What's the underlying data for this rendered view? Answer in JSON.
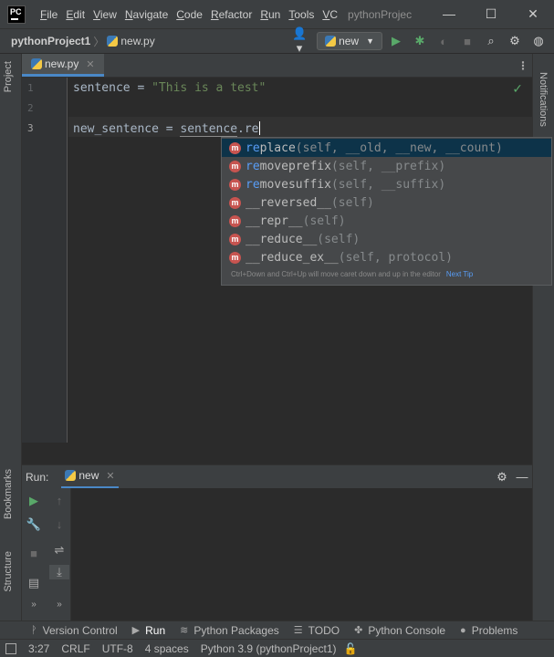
{
  "titlebar": {
    "logo_text": "PC",
    "menu": [
      "File",
      "Edit",
      "View",
      "Navigate",
      "Code",
      "Refactor",
      "Run",
      "Tools",
      "VC"
    ],
    "title": "pythonProjec",
    "minimize": "—",
    "maximize": "☐",
    "close": "✕"
  },
  "navbar": {
    "project": "pythonProject1",
    "file": "new.py",
    "run_config": "new"
  },
  "left_stripe": {
    "project_tab": "Project",
    "bookmarks_tab": "Bookmarks",
    "structure_tab": "Structure"
  },
  "right_stripe": {
    "notifications_tab": "Notifications"
  },
  "editor": {
    "tab_label": "new.py",
    "line_numbers": [
      "1",
      "2",
      "3"
    ],
    "line1_ident": "sentence",
    "line1_op": " = ",
    "line1_string": "\"This is a test\"",
    "line3_prefix": "new_sentence = ",
    "line3_ident": "sentence",
    "line3_dot": ".re"
  },
  "completion": {
    "items": [
      {
        "match": "re",
        "rest": "place",
        "sig": "(self, __old, __new, __count)"
      },
      {
        "match": "re",
        "rest": "moveprefix",
        "sig": "(self, __prefix)"
      },
      {
        "match": "re",
        "rest": "movesuffix",
        "sig": "(self, __suffix)"
      },
      {
        "match": "",
        "rest": "__reversed__",
        "sig": "(self)"
      },
      {
        "match": "",
        "rest": "__repr__",
        "sig": "(self)"
      },
      {
        "match": "",
        "rest": "__reduce__",
        "sig": "(self)"
      },
      {
        "match": "",
        "rest": "__reduce_ex__",
        "sig": "(self, protocol)"
      }
    ],
    "icon_letter": "m",
    "hint": "Ctrl+Down and Ctrl+Up will move caret down and up in the editor",
    "next_tip": "Next Tip"
  },
  "run": {
    "label": "Run:",
    "tab": "new"
  },
  "bottom_tabs": [
    {
      "icon": "ᚹ",
      "label": "Version Control",
      "active": false
    },
    {
      "icon": "▶",
      "label": "Run",
      "active": true
    },
    {
      "icon": "≋",
      "label": "Python Packages",
      "active": false
    },
    {
      "icon": "☰",
      "label": "TODO",
      "active": false
    },
    {
      "icon": "✤",
      "label": "Python Console",
      "active": false
    },
    {
      "icon": "●",
      "label": "Problems",
      "active": false
    }
  ],
  "status": {
    "position": "3:27",
    "line_sep": "CRLF",
    "encoding": "UTF-8",
    "indent": "4 spaces",
    "interpreter": "Python 3.9 (pythonProject1)"
  }
}
